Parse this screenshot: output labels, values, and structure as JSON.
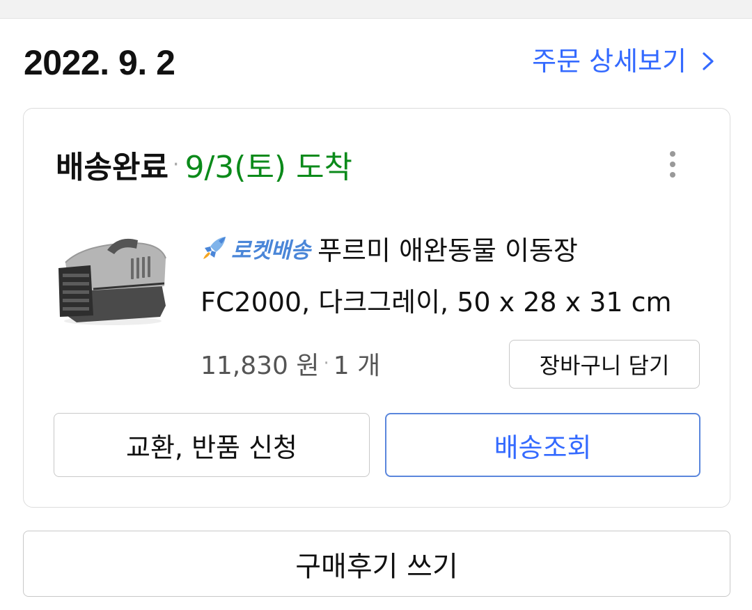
{
  "order": {
    "date": "2022. 9. 2",
    "detail_link_label": "주문 상세보기"
  },
  "shipment": {
    "status": "배송완료",
    "arrival": "9/3(토) 도착"
  },
  "product": {
    "badge": "로켓배송",
    "name_line1": "푸르미 애완동물 이동장",
    "name_line2": "FC2000, 다크그레이, 50 x 28 x 31 cm",
    "price": "11,830 원",
    "quantity": "1 개",
    "cart_button": "장바구니 담기"
  },
  "actions": {
    "return_button": "교환, 반품 신청",
    "tracking_button": "배송조회",
    "review_button": "구매후기 쓰기"
  },
  "colors": {
    "link_blue": "#346aff",
    "arrival_green": "#0b8a1a",
    "rocket_blue": "#4a86d8"
  },
  "icons": {
    "more": "more-vertical-icon",
    "chevron": "chevron-right-icon",
    "rocket": "rocket-icon"
  }
}
